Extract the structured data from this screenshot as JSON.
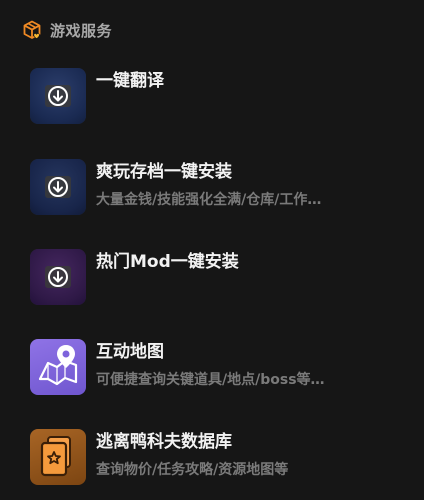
{
  "section": {
    "title": "游戏服务",
    "icon": "package-heart-icon",
    "icon_color": "#f08a24"
  },
  "items": [
    {
      "title": "一键翻译",
      "subtitle": "",
      "icon": "download-circle-icon",
      "tile_color": "#1f3566"
    },
    {
      "title": "爽玩存档一键安装",
      "subtitle": "大量金钱/技能强化全满/仓库/工作…",
      "icon": "download-circle-icon",
      "tile_color": "#1d2b50"
    },
    {
      "title": "热门Mod一键安装",
      "subtitle": "",
      "icon": "download-circle-icon",
      "tile_color": "#3a1f55"
    },
    {
      "title": "互动地图",
      "subtitle": "可便捷查询关键道具/地点/boss等…",
      "icon": "map-pin-icon",
      "tile_color": "#7d63db"
    },
    {
      "title": "逃离鸭科夫数据库",
      "subtitle": "查询物价/任务攻略/资源地图等",
      "icon": "database-cards-icon",
      "tile_color": "#94561c"
    }
  ],
  "colors": {
    "background": "#161616",
    "title_text": "#f2f2f2",
    "subtitle_text": "#7a7a7a",
    "header_text": "#a8a8a8"
  }
}
